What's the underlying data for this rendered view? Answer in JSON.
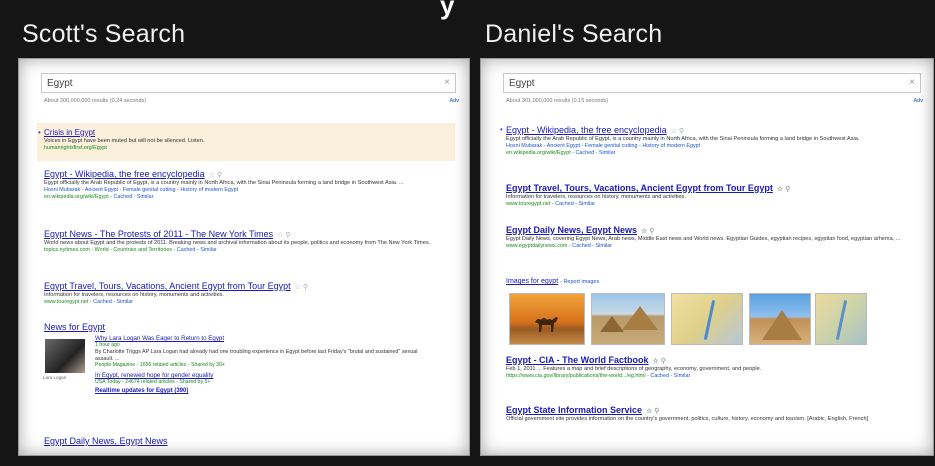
{
  "header": {
    "cut_title": "y"
  },
  "colors": {
    "background": "#151515",
    "link": "#1a1ab8",
    "url": "#1a8a1a",
    "ad_background": "#fbf0dc"
  },
  "left": {
    "title": "Scott's Search",
    "search": {
      "query": "Egypt",
      "clear_icon": "close-icon"
    },
    "stats": "About 300,000,000 results (0.24 seconds)",
    "advanced": "Adv",
    "ad": {
      "title": "Crisis in Egypt",
      "text": "Voices in Egypt have been muted but will not be silenced. Listen.",
      "url": "humanrightsfirst.org/Egypt"
    },
    "results": [
      {
        "title": "Egypt - Wikipedia, the free encyclopedia",
        "snippet": "Egypt officially the Arab Republic of Egypt, is a country mainly in North Africa, with the Sinai Peninsula forming a land bridge in Southwest Asia. ...",
        "links": "Hosni Mubarak - Ancient Egypt - Female genital cutting - History of modern Egypt",
        "url": "en.wikipedia.org/wiki/Egypt",
        "cache": "Cached - Similar"
      },
      {
        "title": "Egypt News - The Protests of 2011 - The New York Times",
        "snippet": "World news about Egypt and the protests of 2011. Breaking news and archival information about its people, politics and economy from The New York Times.",
        "links": "",
        "url": "topics.nytimes.com - World - Countries and Territories",
        "cache": "Cached - Similar"
      },
      {
        "title": "Egypt Travel, Tours, Vacations, Ancient Egypt from Tour Egypt",
        "snippet": "Information for travelers, resources on history, monuments and activities.",
        "links": "",
        "url": "www.touregypt.net",
        "cache": "Cached - Similar"
      }
    ],
    "news": {
      "heading": "News for Egypt",
      "thumb_caption": "Lara Logan",
      "item1_title": "Why Lara Logan Was Eager to Return to Egypt",
      "item1_time": "1 hour ago",
      "item1_text": "By Charlotte Triggs AP Lara Logan had already had one troubling experience in Egypt before last Friday's \"brutal and sustained\" sexual assault. ...",
      "item1_source": "People Magazine - 1656 related articles - Shared by 30+",
      "item2_title": "In Egypt, renewed hope for gender equality",
      "item2_source": "USA Today - 24674 related articles - Shared by 5+",
      "more": "Realtime updates for Egypt (390)"
    },
    "bottom_result": "Egypt Daily News, Egypt News"
  },
  "right": {
    "title": "Daniel's Search",
    "search": {
      "query": "Egypt",
      "clear_icon": "close-icon"
    },
    "stats": "About 301,000,000 results (0.15 seconds)",
    "advanced": "Adv",
    "results": [
      {
        "title": "Egypt - Wikipedia, the free encyclopedia",
        "snippet": "Egypt officially the Arab Republic of Egypt, is a country mainly in North Africa, with the Sinai Peninsula forming a land bridge in Southwest Asia.",
        "links": "Hosni Mubarak - Ancient Egypt - Female genital cutting - History of modern Egypt",
        "url": "en.wikipedia.org/wiki/Egypt",
        "cache": "Cached - Similar"
      },
      {
        "title": "Egypt Travel, Tours, Vacations, Ancient Egypt from Tour Egypt",
        "snippet": "Information for travelers, resources on history, monuments and activities.",
        "links": "",
        "url": "www.touregypt.net",
        "cache": "Cached - Similar"
      },
      {
        "title": "Egypt Daily News, Egypt News",
        "snippet": "Egypt Daily News, covering Egypt News, Arab news, Middle East news and World news. Egyptian Guides, egyptian recipes, egyptian food, egyptian arhema, ...",
        "links": "",
        "url": "www.egyptdailynews.com",
        "cache": "Cached - Similar"
      }
    ],
    "images": {
      "heading": "Images for egypt",
      "report": "- Report images"
    },
    "results2": [
      {
        "title": "Egypt - CIA - The World Factbook",
        "snippet": "Feb 1, 2011 ... Features a map and brief descriptions of geography, economy, government, and people.",
        "url": "https://www.cia.gov/library/publications/the-world.../eg.html",
        "cache": "Cached - Similar"
      },
      {
        "title": "Egypt State Information Service",
        "snippet": "Official government site provides information on the country's government, politics, culture, history, economy and tourism. [Arabic, English, French]",
        "url": "",
        "cache": ""
      }
    ]
  }
}
